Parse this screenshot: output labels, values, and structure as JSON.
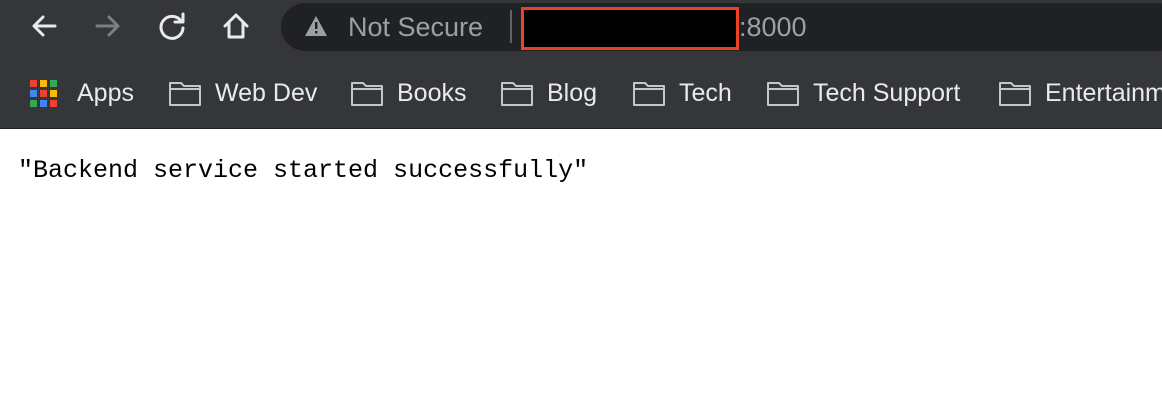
{
  "toolbar": {
    "back_icon": "back-arrow-icon",
    "forward_icon": "forward-arrow-icon",
    "reload_icon": "reload-icon",
    "home_icon": "home-icon"
  },
  "omnibox": {
    "security_icon": "warning-triangle-icon",
    "security_label": "Not Secure",
    "port": ":8000",
    "redaction_border_color": "#e94226"
  },
  "bookmarks": {
    "items": [
      {
        "label": "Apps",
        "icon": "apps-grid-icon"
      },
      {
        "label": "Web Dev",
        "icon": "folder-icon"
      },
      {
        "label": "Books",
        "icon": "folder-icon"
      },
      {
        "label": "Blog",
        "icon": "folder-icon"
      },
      {
        "label": "Tech",
        "icon": "folder-icon"
      },
      {
        "label": "Tech Support",
        "icon": "folder-icon"
      },
      {
        "label": "Entertainm",
        "icon": "folder-icon"
      }
    ]
  },
  "content": {
    "text": "\"Backend service started successfully\""
  },
  "colors": {
    "toolbar_bg": "#35363a",
    "omnibox_bg": "#202124",
    "muted_text": "#9aa0a6",
    "bookmark_text": "#e8eaed",
    "page_bg": "#ffffff"
  }
}
